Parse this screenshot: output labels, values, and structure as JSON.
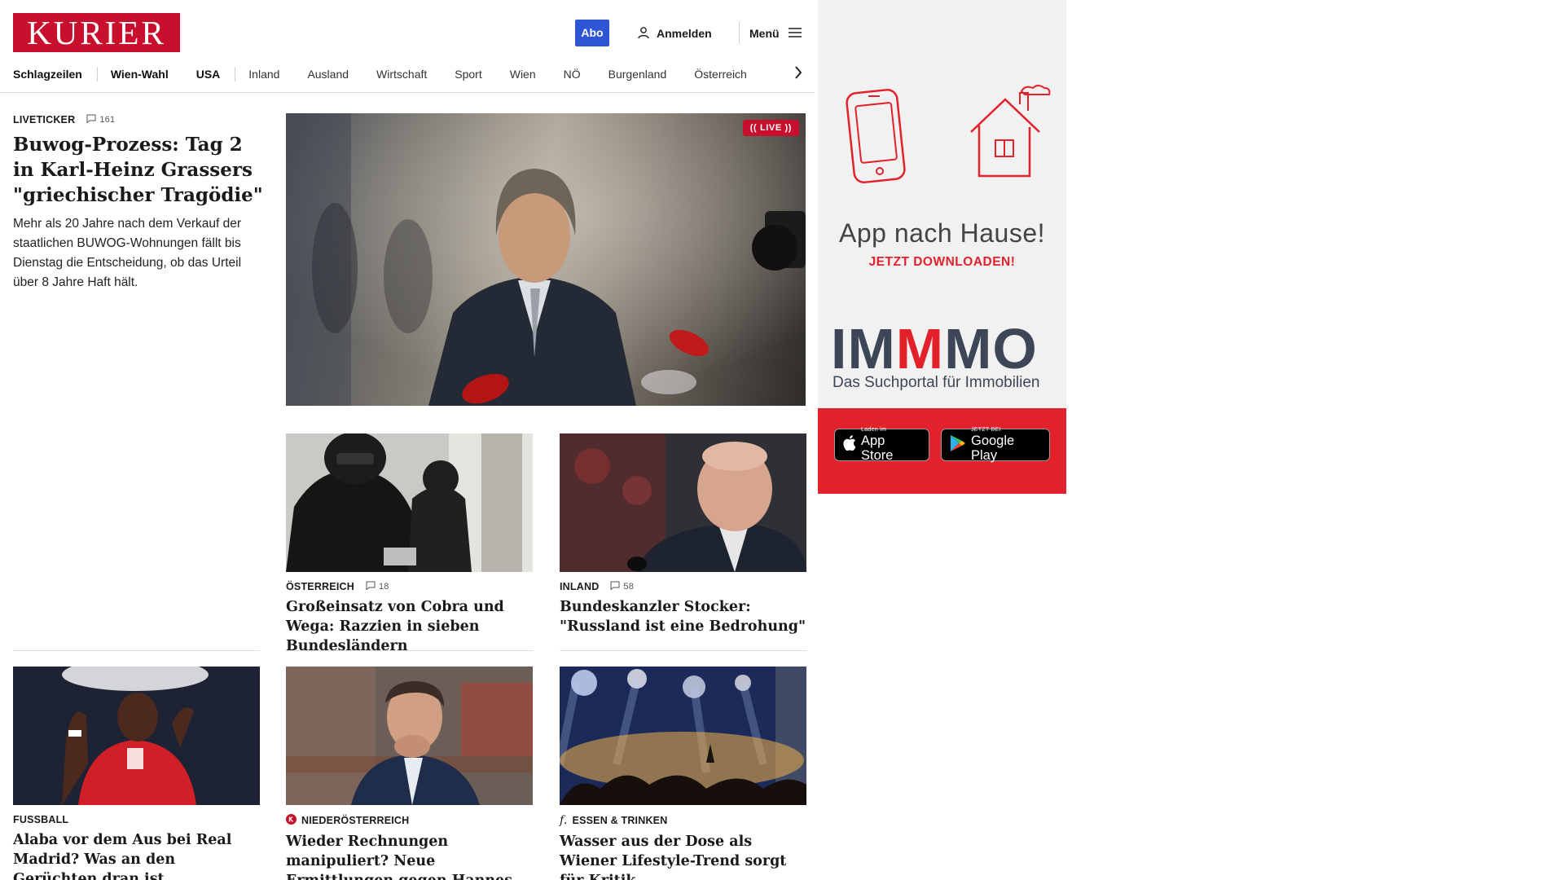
{
  "header": {
    "logo_text": "KURIER",
    "logo_color": "#c8102e",
    "abo_label": "Abo",
    "abo_color": "#2d55d6",
    "login_label": "Anmelden",
    "login_icon": "user-icon",
    "menu_label": "Menü",
    "menu_icon": "hamburger-icon"
  },
  "nav": {
    "items": [
      "Schlagzeilen",
      "Wien-Wahl",
      "USA",
      "Inland",
      "Ausland",
      "Wirtschaft",
      "Sport",
      "Wien",
      "NÖ",
      "Burgenland",
      "Österreich"
    ],
    "next_icon": "chevron-right-icon"
  },
  "lead_story": {
    "kicker": "LIVETICKER",
    "comment_count": "161",
    "headline": "Buwog-Prozess: Tag 2 in Karl-Heinz Grassers \"griechischer Tragödie\"",
    "teaser": "Mehr als 20 Jahre nach dem Verkauf der staatlichen BUWOG-Wohnungen fällt bis Dienstag die Entscheidung, ob das Urteil über 8 Jahre Haft hält.",
    "image_badge": "LIVE"
  },
  "cards": [
    {
      "kicker": "ÖSTERREICH",
      "comment_count": "18",
      "headline": "Großeinsatz von Cobra und Wega: Razzien in sieben Bundesländern"
    },
    {
      "kicker": "INLAND",
      "comment_count": "58",
      "headline": "Bundeskanzler Stocker: \"Russland ist eine Bedrohung\""
    },
    {
      "kicker": "FUSSBALL",
      "headline": "Alaba vor dem Aus bei Real Madrid? Was an den Gerüchten dran ist"
    },
    {
      "kicker": "NIEDERÖSTERREICH",
      "kicker_icon": "kurier-k-icon",
      "headline": "Wieder Rechnungen manipuliert? Neue Ermittlungen gegen Hannes Koza"
    },
    {
      "kicker": "ESSEN & TRINKEN",
      "kicker_icon": "f-icon",
      "headline": "Wasser aus der Dose als Wiener Lifestyle-Trend sorgt für Kritik"
    }
  ],
  "ad": {
    "headline": "App nach Hause!",
    "subline": "JETZT DOWNLOADEN!",
    "brand_prefix": "IM",
    "brand_accent": "M",
    "brand_suffix": "MO",
    "tagline": "Das Suchportal für Immobilien",
    "accent_color": "#e3212b",
    "app_store_small": "Laden im",
    "app_store_big": "App Store",
    "google_play_small": "JETZT BEI",
    "google_play_big": "Google Play"
  }
}
